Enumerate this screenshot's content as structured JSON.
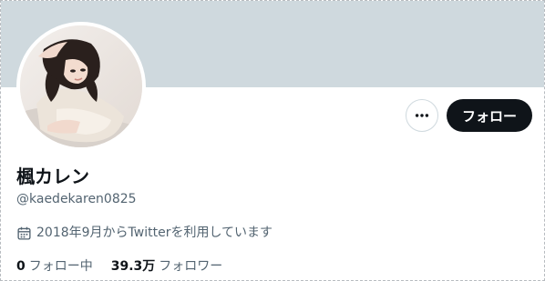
{
  "profile": {
    "display_name": "楓カレン",
    "handle": "@kaedekaren0825",
    "joined_text": "2018年9月からTwitterを利用しています",
    "joined_icon": "calendar-icon",
    "avatar_alt": "profile photo"
  },
  "actions": {
    "follow_label": "フォロー",
    "more_icon": "more-horizontal-icon"
  },
  "stats": {
    "following_count": "0",
    "following_label": "フォロー中",
    "followers_count": "39.3万",
    "followers_label": "フォロワー"
  },
  "colors": {
    "banner": "#cfd9de",
    "primary_text": "#0f1419",
    "secondary_text": "#536471",
    "follow_button_bg": "#0f1419"
  }
}
